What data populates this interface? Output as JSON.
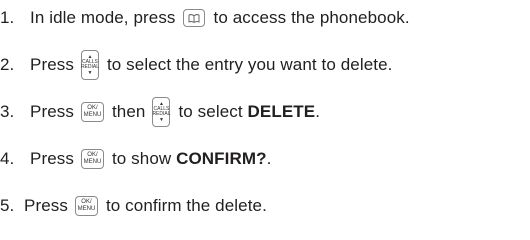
{
  "steps": [
    {
      "number": "1.",
      "parts": [
        {
          "t": "text",
          "v": "In idle mode, press"
        },
        {
          "t": "key",
          "k": "phonebook"
        },
        {
          "t": "text",
          "v": "to access the phonebook."
        }
      ]
    },
    {
      "number": "2.",
      "parts": [
        {
          "t": "text",
          "v": "Press"
        },
        {
          "t": "key",
          "k": "calls"
        },
        {
          "t": "text",
          "v": "to select the entry you want to delete."
        }
      ]
    },
    {
      "number": "3.",
      "parts": [
        {
          "t": "text",
          "v": "Press"
        },
        {
          "t": "key",
          "k": "ok"
        },
        {
          "t": "text",
          "v": "then"
        },
        {
          "t": "key",
          "k": "calls"
        },
        {
          "t": "text",
          "v": "to select "
        },
        {
          "t": "bold",
          "v": "DELETE"
        },
        {
          "t": "text",
          "v": "."
        }
      ]
    },
    {
      "number": "4.",
      "parts": [
        {
          "t": "text",
          "v": "Press"
        },
        {
          "t": "key",
          "k": "ok"
        },
        {
          "t": "text",
          "v": "to show "
        },
        {
          "t": "bold",
          "v": "CONFIRM?"
        },
        {
          "t": "text",
          "v": "."
        }
      ]
    },
    {
      "number": "5.",
      "parts": [
        {
          "t": "text",
          "v": "Press"
        },
        {
          "t": "key",
          "k": "ok"
        },
        {
          "t": "text",
          "v": "to confirm the delete."
        }
      ]
    }
  ],
  "keys": {
    "calls": {
      "top": "CALLS",
      "bottom": "REDIAL",
      "up": "▲",
      "down": "▼",
      "icon": "up-down-calls-redial-key-icon"
    },
    "ok": {
      "top": "OK/",
      "bottom": "MENU",
      "icon": "ok-menu-key-icon"
    },
    "phonebook": {
      "icon": "phonebook-key-icon"
    }
  }
}
